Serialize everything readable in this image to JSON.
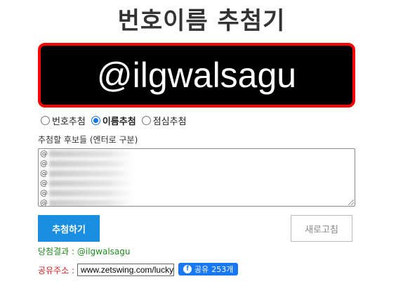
{
  "page": {
    "title": "번호이름 추첨기"
  },
  "result": {
    "text": "@ilgwalsagu"
  },
  "modes": [
    {
      "label": "번호추첨",
      "selected": false
    },
    {
      "label": "이름추첨",
      "selected": true
    },
    {
      "label": "점심추첨",
      "selected": false
    }
  ],
  "candidates": {
    "label": "추첨할 후보들 (엔터로 구분)",
    "lines": [
      "@",
      "@",
      "@",
      "@",
      "@",
      "@"
    ]
  },
  "buttons": {
    "draw": "추첨하기",
    "refresh": "새로고침"
  },
  "winner": {
    "label": "당첨결과 :",
    "value": "@ilgwalsagu"
  },
  "share": {
    "label": "공유주소 :",
    "url": "www.zetswing.com/lucky",
    "fb_icon": "facebook-icon",
    "fb_label": "공유",
    "fb_count": "253개"
  },
  "colors": {
    "result_bg": "#000000",
    "result_border": "#ff0000",
    "primary_button": "#1a8ee0",
    "winner_text": "#1e8c1e",
    "share_label": "#e02020",
    "facebook": "#1877f2"
  }
}
